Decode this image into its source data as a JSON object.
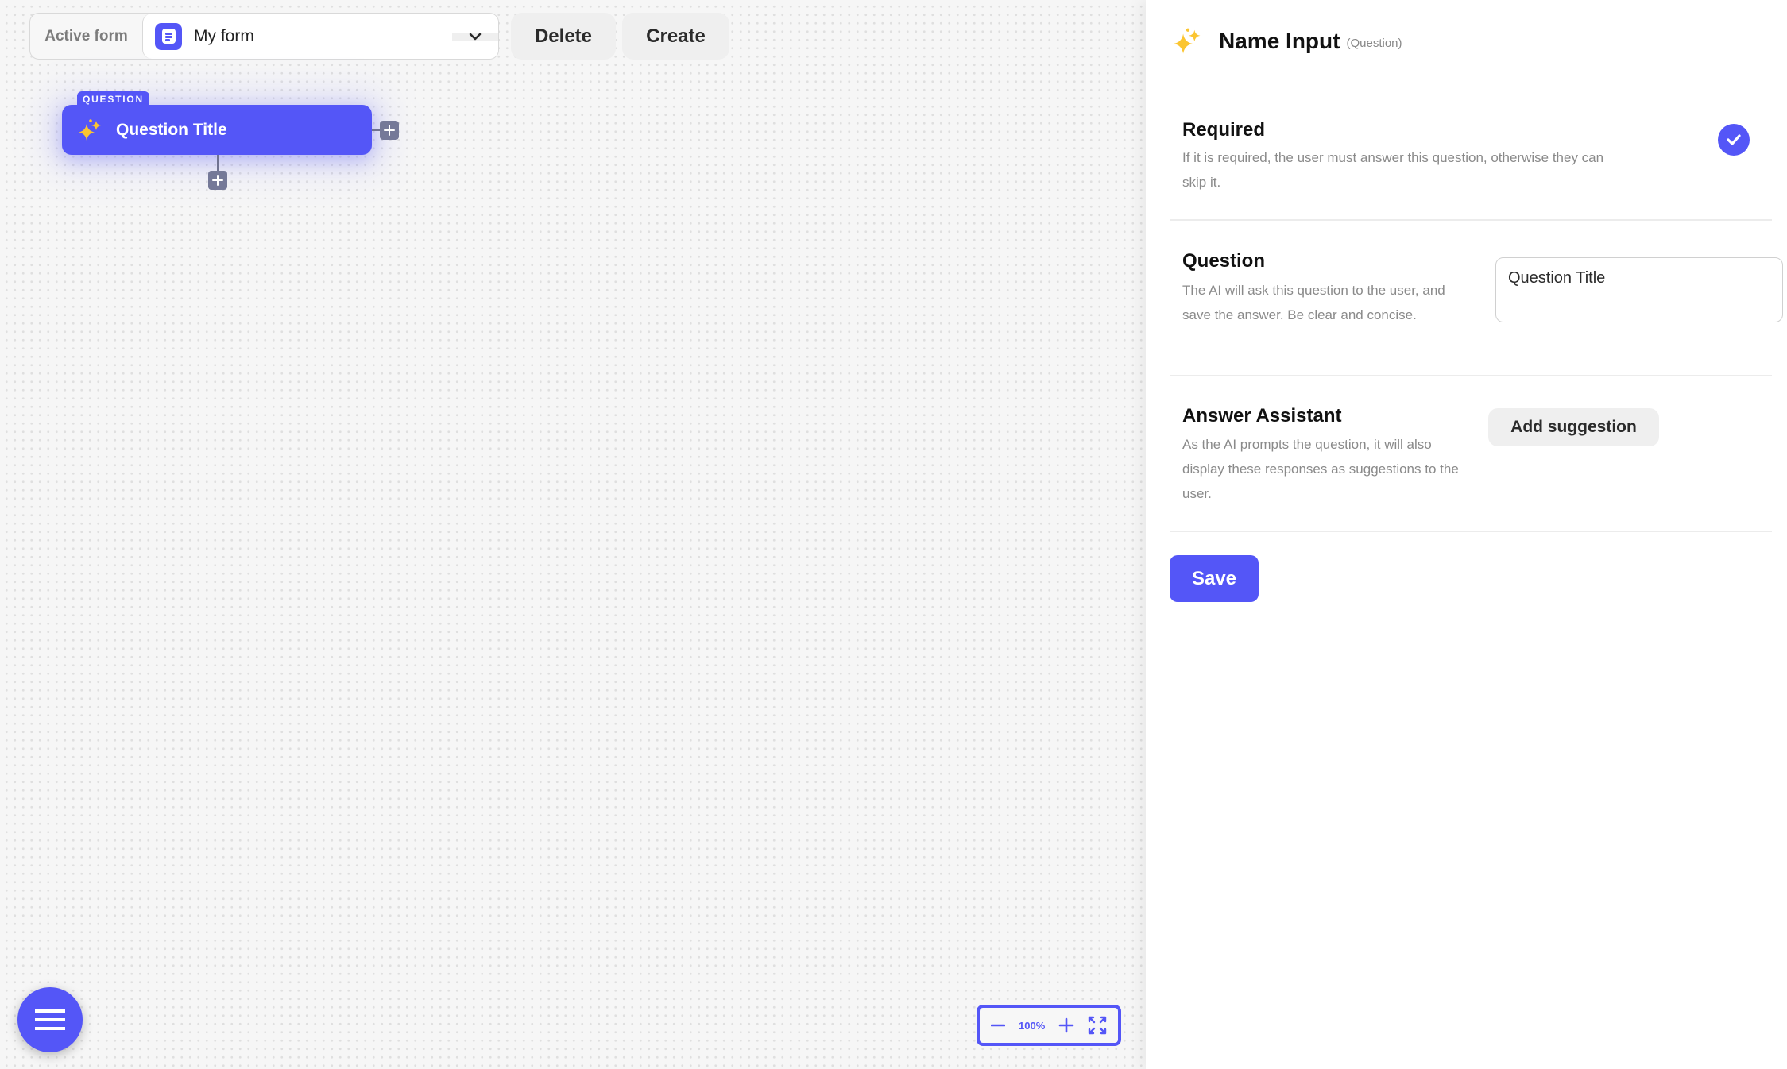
{
  "toolbar": {
    "active_form_label": "Active form",
    "selected_form": "My form",
    "form_icon": "form-document-icon",
    "dropdown_icon": "chevron-down-icon",
    "delete_label": "Delete",
    "create_label": "Create"
  },
  "canvas": {
    "nodes": [
      {
        "type_tag": "QUESTION",
        "title": "Question Title",
        "icon": "sparkles-icon"
      }
    ],
    "zoom": {
      "level": "100%",
      "zoom_out_icon": "minus-icon",
      "zoom_in_icon": "plus-icon",
      "fit_icon": "fit-view-icon"
    },
    "menu_icon": "hamburger-menu-icon"
  },
  "panel": {
    "title": "Name Input",
    "subtitle": "(Question)",
    "icon": "sparkles-icon",
    "sections": {
      "required": {
        "title": "Required",
        "description": "If it is required, the user must answer this question, otherwise they can skip it.",
        "checked": true
      },
      "question": {
        "title": "Question",
        "description": "The AI will ask this question to the user, and save the answer. Be clear and concise.",
        "value": "Question Title"
      },
      "answer_assistant": {
        "title": "Answer Assistant",
        "description": "As the AI prompts the question, it will also display these responses as suggestions to the user.",
        "button_label": "Add suggestion"
      }
    },
    "save_label": "Save"
  },
  "colors": {
    "accent": "#5456f7",
    "canvas_bg": "#f6f6f6",
    "sparkle": "#fbc531",
    "plus_handle": "#757998"
  }
}
